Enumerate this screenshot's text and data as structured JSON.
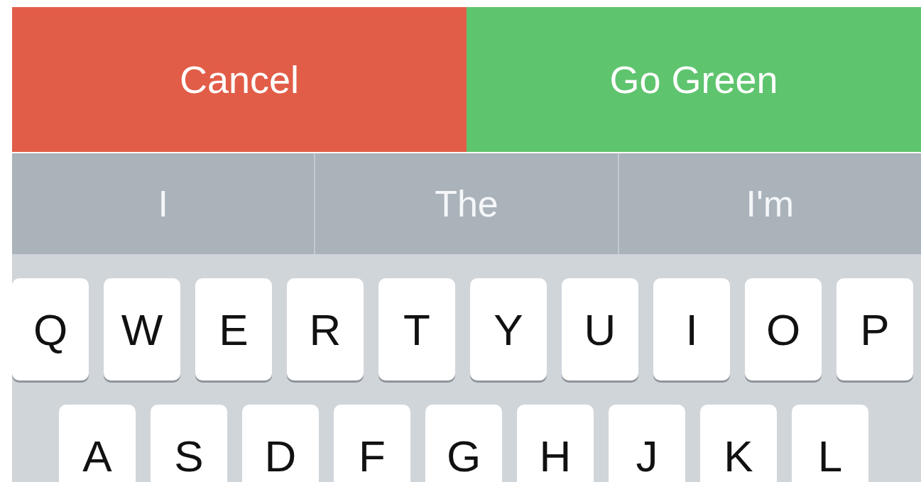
{
  "action_buttons": [
    {
      "label": "Cancel",
      "kind": "cancel"
    },
    {
      "label": "Go Green",
      "kind": "confirm"
    }
  ],
  "suggestions": [
    "I",
    "The",
    "I'm"
  ],
  "keyboard": {
    "rows": [
      [
        "Q",
        "W",
        "E",
        "R",
        "T",
        "Y",
        "U",
        "I",
        "O",
        "P"
      ],
      [
        "A",
        "S",
        "D",
        "F",
        "G",
        "H",
        "J",
        "K",
        "L"
      ]
    ]
  }
}
